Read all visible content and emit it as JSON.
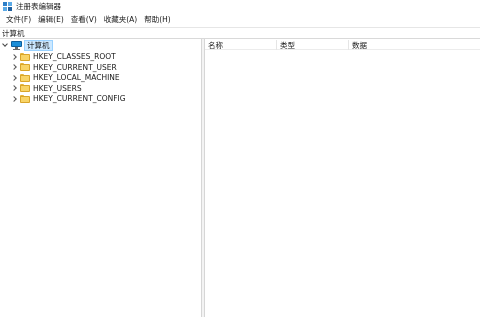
{
  "window": {
    "title": "注册表编辑器"
  },
  "menu": [
    "文件(F)",
    "编辑(E)",
    "查看(V)",
    "收藏夹(A)",
    "帮助(H)"
  ],
  "address": "计算机",
  "tree": {
    "root": "计算机",
    "children": [
      "HKEY_CLASSES_ROOT",
      "HKEY_CURRENT_USER",
      "HKEY_LOCAL_MACHINE",
      "HKEY_USERS",
      "HKEY_CURRENT_CONFIG"
    ]
  },
  "columns": {
    "name": "名称",
    "type": "类型",
    "data": "数据"
  },
  "colors": {
    "selection_bg": "#cce8ff",
    "folder": "#f8d467",
    "monitor": "#1e8fd8"
  },
  "icons": [
    "registry-editor-icon",
    "computer-icon",
    "folder-icon",
    "chevron-down-icon",
    "chevron-right-icon"
  ]
}
